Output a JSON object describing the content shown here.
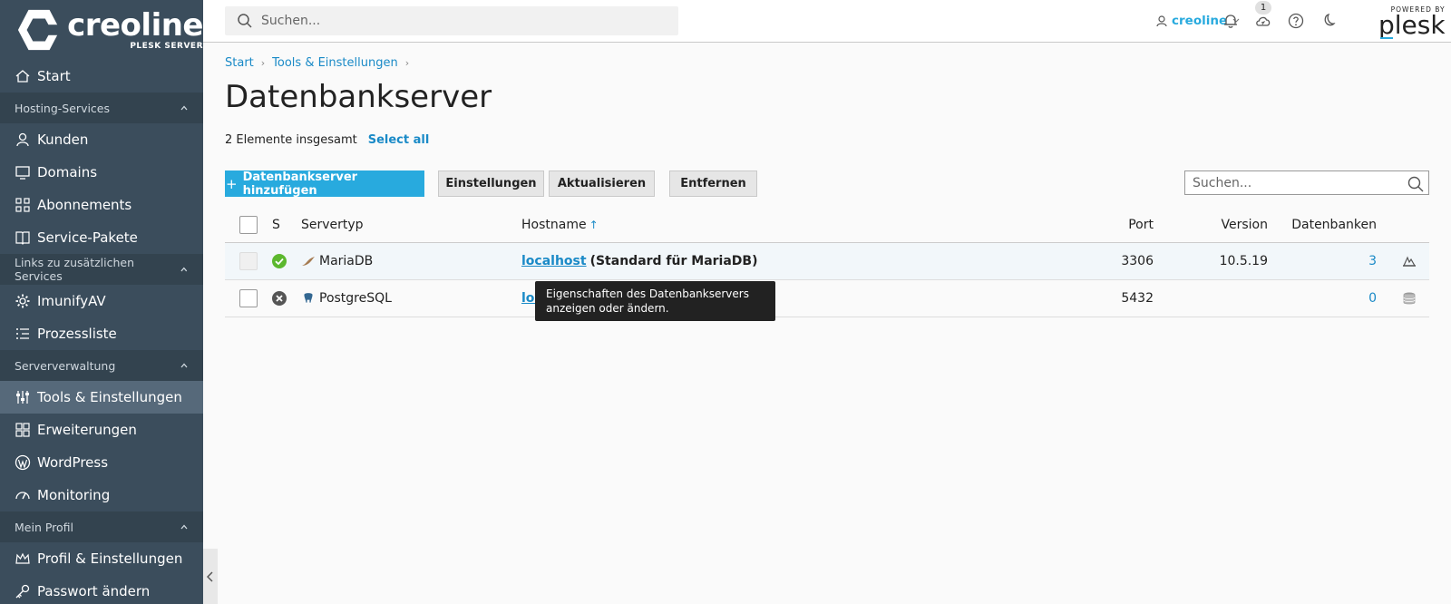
{
  "brand": {
    "name": "creoline",
    "sub": "PLESK SERVER"
  },
  "sidebar": {
    "items": [
      {
        "type": "item",
        "label": "Start",
        "icon": "home-icon"
      },
      {
        "type": "section",
        "label": "Hosting-Services"
      },
      {
        "type": "item",
        "label": "Kunden",
        "icon": "user-icon"
      },
      {
        "type": "item",
        "label": "Domains",
        "icon": "monitor-icon"
      },
      {
        "type": "item",
        "label": "Abonnements",
        "icon": "grid-icon"
      },
      {
        "type": "item",
        "label": "Service-Pakete",
        "icon": "book-icon"
      },
      {
        "type": "section",
        "label": "Links zu zusätzlichen Services"
      },
      {
        "type": "item",
        "label": "ImunifyAV",
        "icon": "gear-icon"
      },
      {
        "type": "item",
        "label": "Prozessliste",
        "icon": "list-icon"
      },
      {
        "type": "section",
        "label": "Serververwaltung"
      },
      {
        "type": "item",
        "label": "Tools & Einstellungen",
        "icon": "sliders-icon",
        "active": true
      },
      {
        "type": "item",
        "label": "Erweiterungen",
        "icon": "extensions-icon"
      },
      {
        "type": "item",
        "label": "WordPress",
        "icon": "wordpress-icon"
      },
      {
        "type": "item",
        "label": "Monitoring",
        "icon": "gauge-icon"
      },
      {
        "type": "section",
        "label": "Mein Profil"
      },
      {
        "type": "item",
        "label": "Profil & Einstellungen",
        "icon": "crown-icon"
      },
      {
        "type": "item",
        "label": "Passwort ändern",
        "icon": "key-icon"
      }
    ]
  },
  "header": {
    "search_placeholder": "Suchen...",
    "user": "creoline",
    "notifications_count": "1",
    "powered_label": "POWERED BY",
    "powered_name": "plesk"
  },
  "breadcrumb": [
    "Start",
    "Tools & Einstellungen"
  ],
  "page": {
    "title": "Datenbankserver",
    "count_text": "2 Elemente insgesamt",
    "select_all": "Select all"
  },
  "toolbar": {
    "add_label": "Datenbankserver hinzufügen",
    "settings_label": "Einstellungen",
    "refresh_label": "Aktualisieren",
    "remove_label": "Entfernen",
    "search_placeholder": "Suchen..."
  },
  "table": {
    "columns": {
      "status": "S",
      "type": "Servertyp",
      "hostname": "Hostname",
      "sort_indicator": "↑",
      "port": "Port",
      "version": "Version",
      "databases": "Datenbanken"
    },
    "rows": [
      {
        "status": "ok",
        "type": "MariaDB",
        "hostname_link": "localhost",
        "hostname_note": "(Standard für MariaDB)",
        "port": "3306",
        "version": "10.5.19",
        "databases": "3"
      },
      {
        "status": "error",
        "type": "PostgreSQL",
        "hostname_link": "localhost",
        "hostname_note": "",
        "port": "5432",
        "version": "",
        "databases": "0"
      }
    ]
  },
  "tooltip": {
    "text": "Eigenschaften des Datenbankservers anzeigen oder ändern."
  },
  "colors": {
    "sidebar_bg": "#3b4d5c",
    "accent": "#28aade",
    "link": "#1a8ac7",
    "ok": "#5cb82e",
    "error": "#555555"
  }
}
